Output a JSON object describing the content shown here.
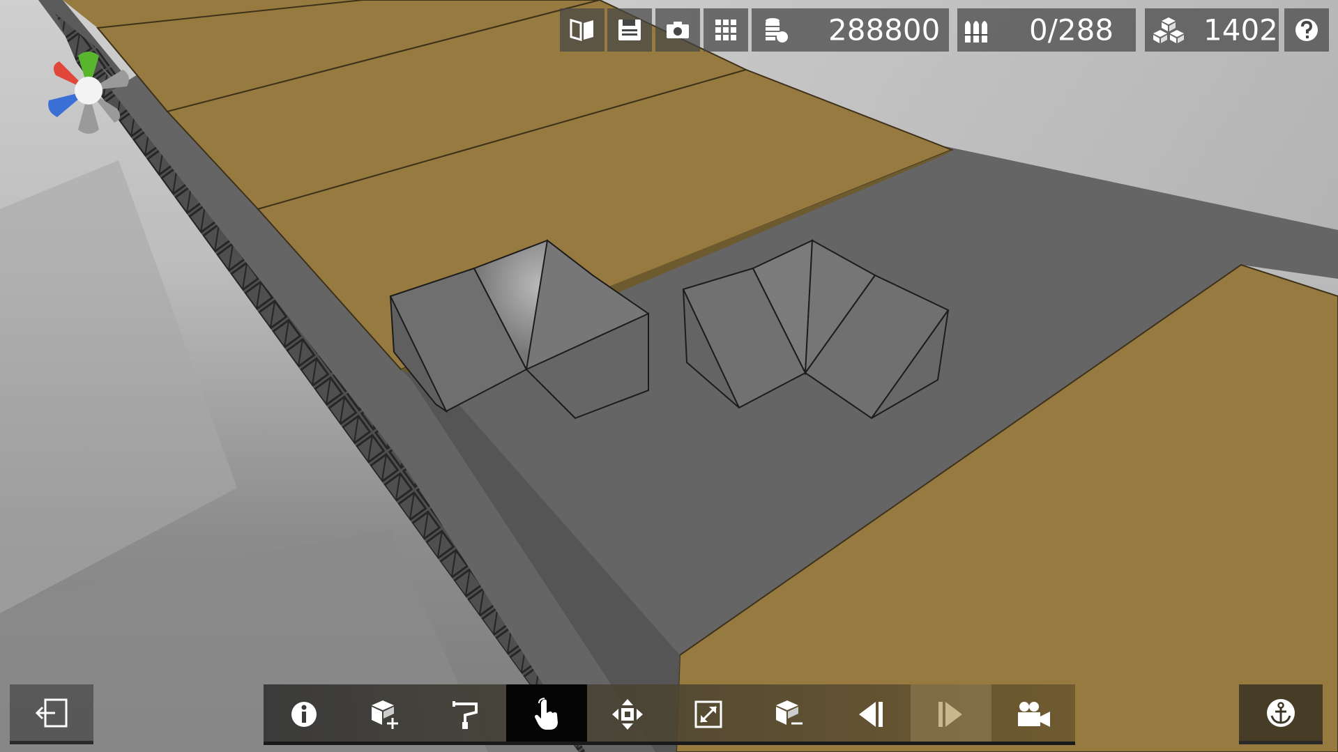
{
  "hud": {
    "coins_value": "288800",
    "ammo_value": "0/288",
    "blocks_value": "1402",
    "icons": {
      "blueprint": "blueprint-book-icon",
      "save": "save-floppy-icon",
      "screenshot": "camera-icon",
      "grid": "grid-icon",
      "coins": "coins-icon",
      "ammo": "ammo-shells-icon",
      "blocks": "blocks-cubes-icon",
      "help": "help-question-icon"
    }
  },
  "toolbar": {
    "tools": [
      {
        "name": "info",
        "icon": "info-icon"
      },
      {
        "name": "add-block",
        "icon": "add-block-icon"
      },
      {
        "name": "paint",
        "icon": "paint-roller-icon"
      },
      {
        "name": "select",
        "icon": "hand-pointer-icon",
        "active": true
      },
      {
        "name": "move",
        "icon": "move-arrows-icon"
      },
      {
        "name": "scale",
        "icon": "resize-icon"
      },
      {
        "name": "remove-block",
        "icon": "remove-block-icon"
      },
      {
        "name": "undo",
        "icon": "step-back-icon"
      },
      {
        "name": "redo",
        "icon": "step-forward-icon",
        "disabled": true
      },
      {
        "name": "camera",
        "icon": "video-camera-icon"
      }
    ],
    "exit_icon": "exit-door-icon",
    "anchor_icon": "anchor-icon"
  },
  "colors": {
    "deck_wood": "#967a3f",
    "hull_grey": "#626262",
    "hud_tile": "#464646",
    "toolbar_active": "#050505",
    "gizmo_x": "#e0473a",
    "gizmo_y": "#5ab52e",
    "gizmo_z": "#3a6fd6"
  }
}
